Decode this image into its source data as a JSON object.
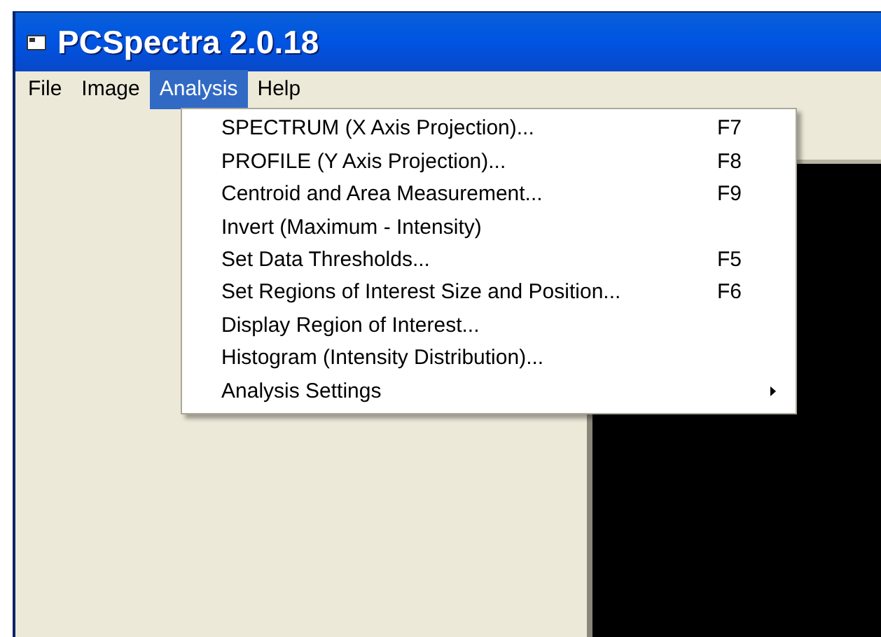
{
  "window": {
    "title": "PCSpectra 2.0.18"
  },
  "menu_bar": [
    {
      "label": "File",
      "selected": false
    },
    {
      "label": "Image",
      "selected": false
    },
    {
      "label": "Analysis",
      "selected": true
    },
    {
      "label": "Help",
      "selected": false
    }
  ],
  "dropdown": [
    {
      "kind": "item",
      "label": "SPECTRUM (X Axis Projection)...",
      "shortcut": "F7"
    },
    {
      "kind": "item",
      "label": "PROFILE (Y Axis Projection)...",
      "shortcut": "F8"
    },
    {
      "kind": "item",
      "label": "Centroid and Area Measurement...",
      "shortcut": "F9"
    },
    {
      "kind": "item",
      "label": "Invert (Maximum - Intensity)"
    },
    {
      "kind": "item",
      "label": "Set Data Thresholds...",
      "shortcut": "F5"
    },
    {
      "kind": "item",
      "label": "Set Regions of Interest Size and Position...",
      "shortcut": "F6"
    },
    {
      "kind": "item",
      "label": "Display Region of Interest..."
    },
    {
      "kind": "item",
      "label": "Histogram (Intensity Distribution)..."
    },
    {
      "kind": "submenu",
      "label": "Analysis Settings"
    }
  ]
}
